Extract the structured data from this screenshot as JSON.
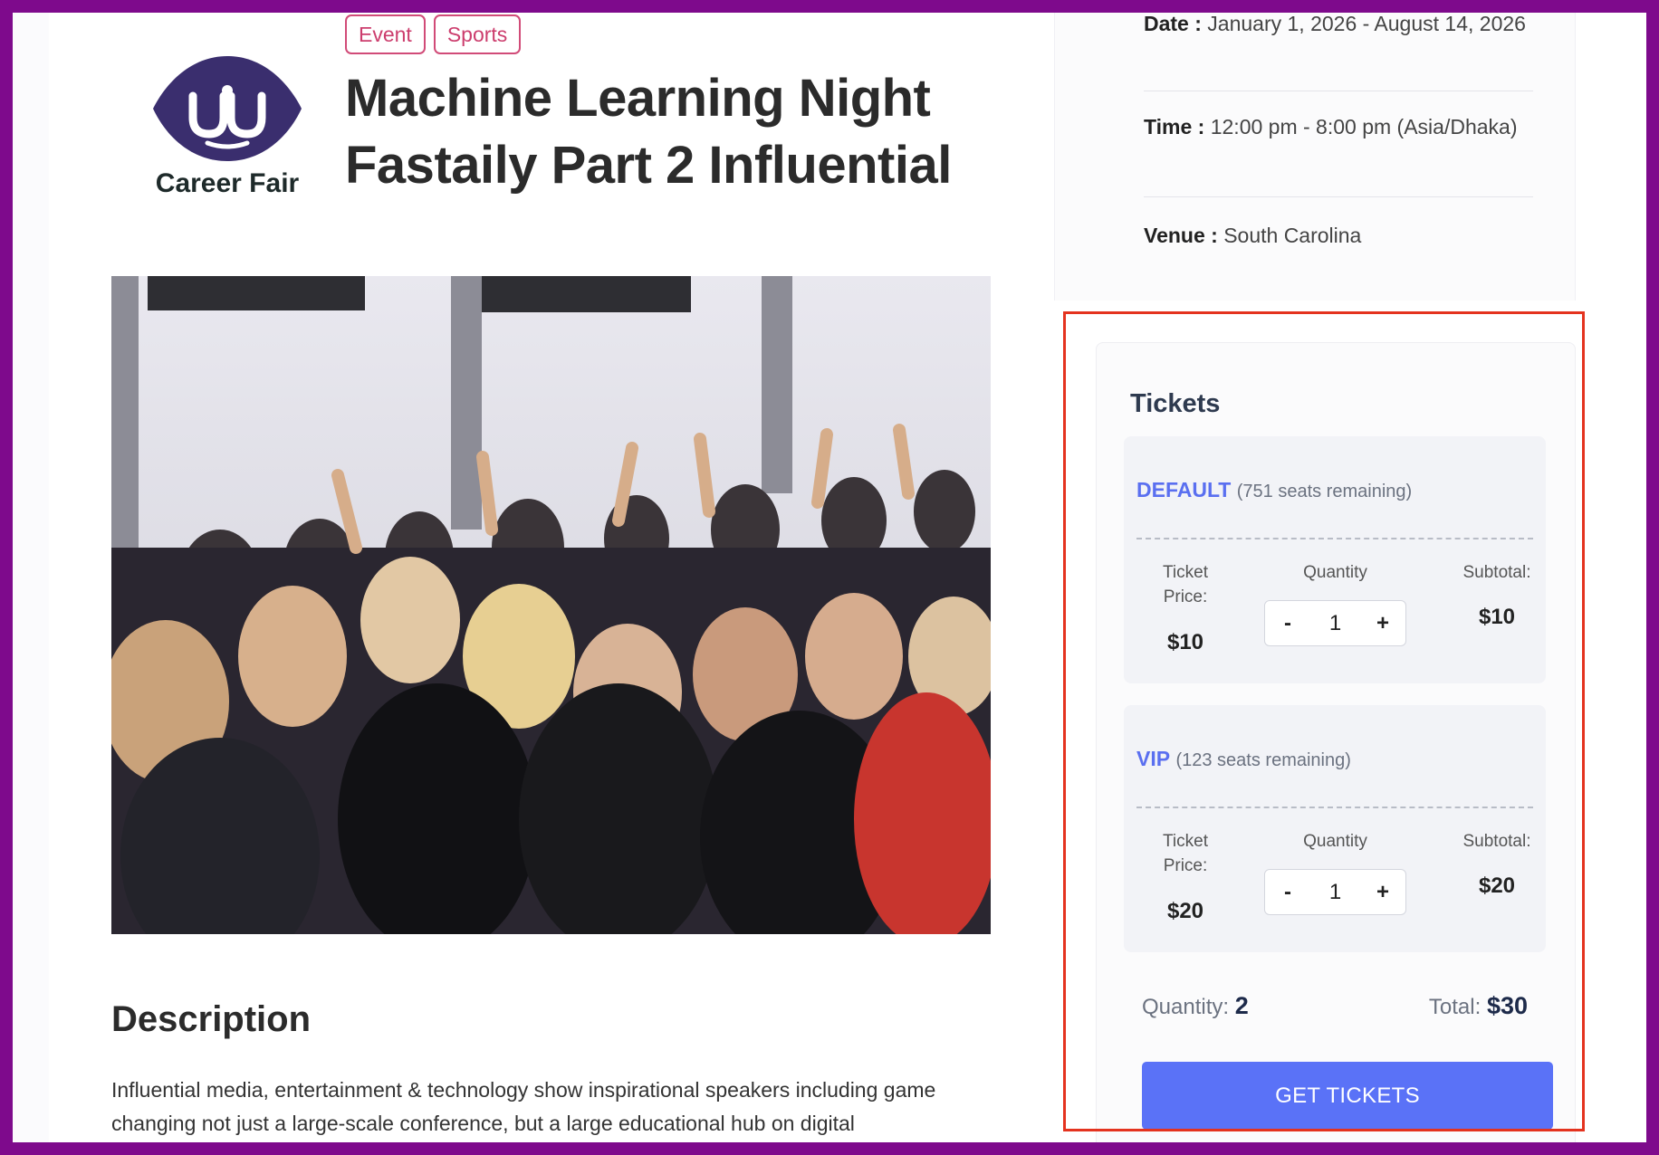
{
  "event": {
    "tags": [
      "Event",
      "Sports"
    ],
    "logo_text": "Career Fair",
    "title": "Machine Learning Night Fastaily Part 2 Influential",
    "hero_alt": "Conference audience raising hands",
    "description_title": "Description",
    "description_text": "Influential media, entertainment & technology show inspirational speakers including game changing not just a large-scale conference, but a large educational hub on digital"
  },
  "info": {
    "date_label": "Date :",
    "date_value": "January 1, 2026 - August 14, 2026",
    "time_label": "Time :",
    "time_value": "12:00 pm - 8:00 pm (Asia/Dhaka)",
    "venue_label": "Venue :",
    "venue_value": "South Carolina"
  },
  "tickets": {
    "title": "Tickets",
    "price_label": "Ticket Price:",
    "quantity_label": "Quantity",
    "subtotal_label": "Subtotal:",
    "items": [
      {
        "name": "DEFAULT",
        "seats": "(751 seats remaining)",
        "price": "$10",
        "quantity": "1",
        "subtotal": "$10"
      },
      {
        "name": "VIP",
        "seats": "(123 seats remaining)",
        "price": "$20",
        "quantity": "1",
        "subtotal": "$20"
      }
    ],
    "minus": "-",
    "plus": "+",
    "summary_quantity_label": "Quantity:",
    "summary_quantity_value": "2",
    "summary_total_label": "Total:",
    "summary_total_value": "$30",
    "cta_label": "GET TICKETS"
  },
  "colors": {
    "accent": "#5a72f7",
    "tag_border": "#d14b78",
    "highlight": "#e4331f",
    "frame": "#7e0a8c"
  }
}
